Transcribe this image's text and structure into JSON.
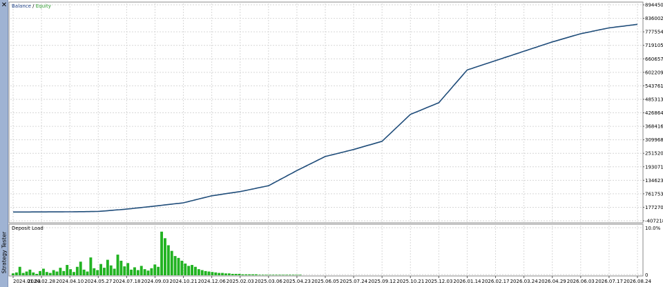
{
  "panel": {
    "title": "Strategy Tester",
    "close_glyph": "✕"
  },
  "main_chart": {
    "legend_series1": "Balance",
    "legend_sep": " / ",
    "legend_series2": "Equity",
    "series1_color": "#1c3f86",
    "series2_color": "#2c9a2c",
    "grid_color": "#d6d6d6"
  },
  "deposit_chart": {
    "title": "Deposit Load",
    "bar_color": "#22b322"
  },
  "chart_data": [
    {
      "type": "line",
      "title": "",
      "legend": [
        "Balance",
        "Equity"
      ],
      "ylim": [
        -407218,
        8944507
      ],
      "y_tick_labels": [
        "8944507",
        "8360024",
        "7775542",
        "7191059",
        "6606577",
        "6022095",
        "5437612",
        "4853130",
        "4268647",
        "3684165",
        "3099682",
        "2515200",
        "1930718",
        "1346235",
        "761753",
        "177270",
        "-407218"
      ],
      "x_tick_labels": [
        "2024.01.03",
        "2024.02.28",
        "2024.04.10",
        "2024.05.27",
        "2024.07.18",
        "2024.09.03",
        "2024.10.21",
        "2024.12.06",
        "2025.02.03",
        "2025.03.06",
        "2025.04.23",
        "2025.06.05",
        "2025.07.24",
        "2025.09.12",
        "2025.10.21",
        "2025.12.03",
        "2026.01.14",
        "2026.02.17",
        "2026.03.24",
        "2026.04.29",
        "2026.06.03",
        "2026.07.17",
        "2026.08.24"
      ],
      "series": [
        {
          "name": "Balance",
          "points": [
            [
              0,
              25000
            ],
            [
              1,
              30000
            ],
            [
              2,
              35000
            ],
            [
              3,
              50000
            ],
            [
              4,
              150000
            ],
            [
              5,
              280000
            ],
            [
              6,
              420000
            ],
            [
              7,
              720000
            ],
            [
              8,
              900000
            ],
            [
              9,
              1150000
            ],
            [
              10,
              1800000
            ],
            [
              11,
              2400000
            ],
            [
              12,
              2700000
            ],
            [
              13,
              3050000
            ],
            [
              14,
              4200000
            ],
            [
              15,
              4700000
            ],
            [
              16,
              6100000
            ],
            [
              17,
              6500000
            ],
            [
              18,
              6900000
            ],
            [
              19,
              7300000
            ],
            [
              20,
              7650000
            ],
            [
              21,
              7900000
            ],
            [
              22,
              8050000
            ]
          ]
        }
      ],
      "grid": true
    },
    {
      "type": "bar",
      "title": "Deposit Load",
      "y_tick_labels": [
        "10.0%",
        "0"
      ],
      "ylim": [
        0,
        10
      ],
      "note": "values in percent",
      "values": [
        0.4,
        0.6,
        1.8,
        0.5,
        0.8,
        1.2,
        0.6,
        0.3,
        0.9,
        1.4,
        0.7,
        0.5,
        1.1,
        0.8,
        1.6,
        0.9,
        2.2,
        1.3,
        0.7,
        1.8,
        2.9,
        1.2,
        0.8,
        3.8,
        1.5,
        1.1,
        2.4,
        1.6,
        3.3,
        2.1,
        1.4,
        4.4,
        3.1,
        1.9,
        2.6,
        1.2,
        1.7,
        1.1,
        2.0,
        1.3,
        1.0,
        1.5,
        2.3,
        1.8,
        9.3,
        7.9,
        6.4,
        5.2,
        4.1,
        3.7,
        3.1,
        2.5,
        2.0,
        2.2,
        1.8,
        1.3,
        1.1,
        0.9,
        0.8,
        0.7,
        0.6,
        0.5,
        0.5,
        0.4,
        0.4,
        0.3,
        0.3,
        0.3,
        0.2,
        0.2,
        0.2,
        0.2,
        0.2,
        0.1,
        0.1,
        0.1,
        0.1,
        0.1,
        0.1,
        0.1,
        0.1,
        0.1,
        0.1,
        0.1,
        0.1,
        0.1
      ]
    }
  ]
}
